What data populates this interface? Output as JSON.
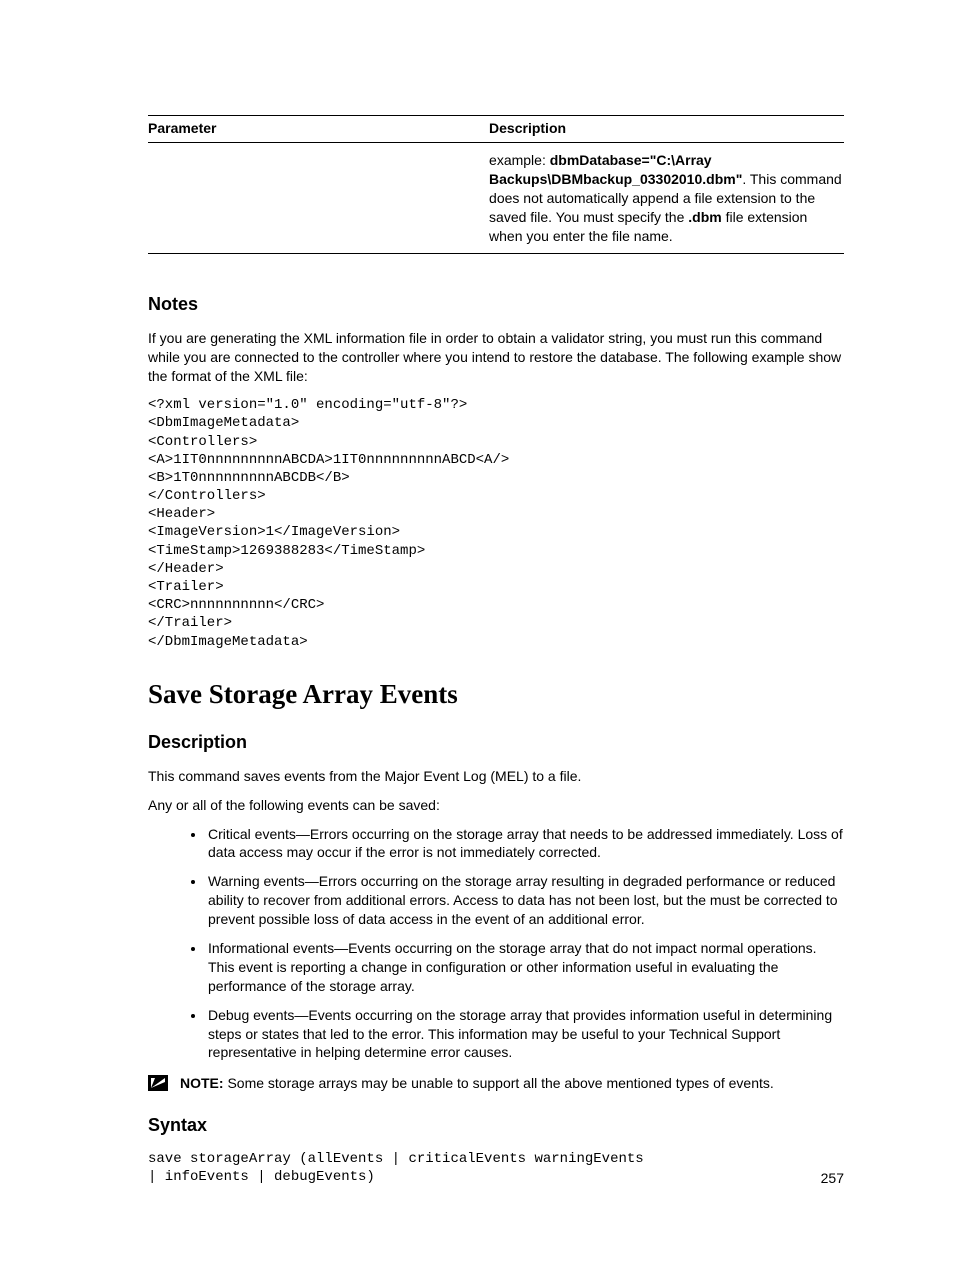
{
  "table": {
    "head_parameter": "Parameter",
    "head_description": "Description",
    "desc_prefix": "example: ",
    "desc_bold1": "dbmDatabase=\"C:\\Array Backups\\DBMbackup_03302010.dbm\"",
    "desc_mid": ". This command does not automatically append a file extension to the saved file. You must specify the ",
    "desc_bold2": ".dbm",
    "desc_suffix": " file extension when you enter the file name."
  },
  "notes": {
    "heading": "Notes",
    "intro": "If you are generating the XML information file in order to obtain a validator string, you must run this command while you are connected to the controller where you intend to restore the database. The following example show the format of the XML file:",
    "xml": "<?xml version=\"1.0\" encoding=\"utf-8\"?>\n<DbmImageMetadata>\n<Controllers>\n<A>1IT0nnnnnnnnnABCDA>1IT0nnnnnnnnnABCD<A/>\n<B>1T0nnnnnnnnnABCDB</B>\n</Controllers>\n<Header>\n<ImageVersion>1</ImageVersion>\n<TimeStamp>1269388283</TimeStamp>\n</Header>\n<Trailer>\n<CRC>nnnnnnnnnn</CRC>\n</Trailer>\n</DbmImageMetadata>"
  },
  "main": {
    "title": "Save Storage Array Events",
    "desc_heading": "Description",
    "desc_p1": "This command saves events from the Major Event Log (MEL) to a file.",
    "desc_p2": "Any or all of the following events can be saved:",
    "bullets": {
      "b1": "Critical events—Errors occurring on the storage array that needs to be addressed immediately. Loss of data access may occur if the error is not immediately corrected.",
      "b2": "Warning events—Errors occurring on the storage array resulting in degraded performance or reduced ability to recover from additional errors. Access to data has not been lost, but the must be corrected to prevent possible loss of data access in the event of an additional error.",
      "b3": "Informational events—Events occurring on the storage array that do not impact normal operations. This event is reporting a change in configuration or other information useful in evaluating the performance of the storage array.",
      "b4": "Debug events—Events occurring on the storage array that provides information useful in determining steps or states that led to the error. This information may be useful to your Technical Support representative in helping determine error causes."
    },
    "note_label": "NOTE: ",
    "note_text": "Some storage arrays may be unable to support all the above mentioned types of events.",
    "syntax_heading": "Syntax",
    "syntax_code": "save storageArray (allEvents | criticalEvents warningEvents\n| infoEvents | debugEvents)"
  },
  "page_number": "257"
}
